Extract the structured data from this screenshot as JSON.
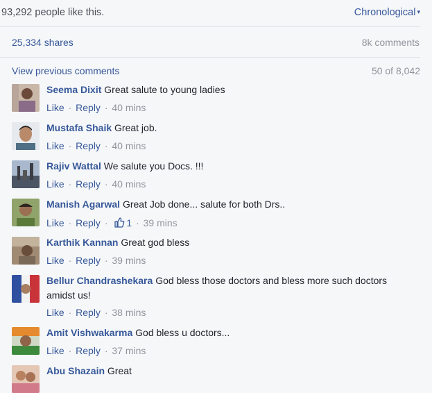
{
  "header": {
    "likes_text": "93,292 people like this.",
    "sort_label": "Chronological",
    "sort_caret": "▾",
    "shares": "25,334 shares",
    "comments_count": "8k comments"
  },
  "pager": {
    "view_previous": "View previous comments",
    "count": "50 of 8,042"
  },
  "actions": {
    "like": "Like",
    "reply": "Reply",
    "sep": "·"
  },
  "comments": [
    {
      "author": "Seema Dixit",
      "text": "Great salute to young ladies",
      "time": "40 mins"
    },
    {
      "author": "Mustafa Shaik",
      "text": "Great job.",
      "time": "40 mins"
    },
    {
      "author": "Rajiv Wattal",
      "text": "We salute you Docs. !!!",
      "time": "40 mins"
    },
    {
      "author": "Manish Agarwal",
      "text": "Great Job done... salute for both Drs..",
      "time": "39 mins",
      "reactions": "1"
    },
    {
      "author": "Karthik Kannan",
      "text": "Great god bless",
      "time": "39 mins"
    },
    {
      "author": "Bellur Chandrashekara",
      "text": "God bless those doctors and bless more such doctors amidst us!",
      "time": "38 mins"
    },
    {
      "author": "Amit Vishwakarma",
      "text": "God bless u doctors...",
      "time": "37 mins"
    },
    {
      "author": "Abu Shazain",
      "text": "Great"
    }
  ],
  "colors": {
    "link": "#365899",
    "muted": "#90949c",
    "background": "#f6f7f9"
  }
}
